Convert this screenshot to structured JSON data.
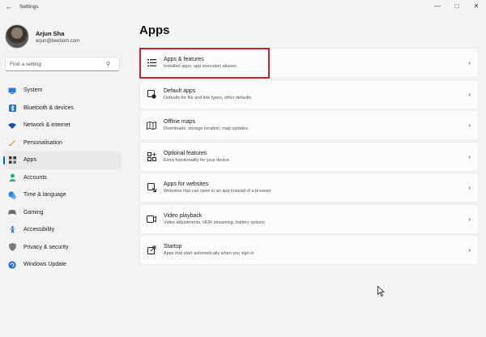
{
  "window": {
    "back_icon": "back-arrow-icon",
    "title": "Settings",
    "controls": [
      "minimize-icon",
      "maximize-icon",
      "close-icon"
    ]
  },
  "profile": {
    "name": "Arjun Sha",
    "email": "arjun@beebom.com"
  },
  "search": {
    "placeholder": "Find a setting",
    "icon": "search-icon"
  },
  "sidebar": {
    "items": [
      {
        "label": "System",
        "icon": "monitor-icon",
        "color": "#2b7cd3"
      },
      {
        "label": "Bluetooth & devices",
        "icon": "bluetooth-icon",
        "color": "#1f6fd1"
      },
      {
        "label": "Network & internet",
        "icon": "wifi-icon",
        "color": "#1f4fa8"
      },
      {
        "label": "Personalisation",
        "icon": "brush-icon",
        "color": "#e0a43a"
      },
      {
        "label": "Apps",
        "icon": "apps-icon",
        "color": "#3a3a3a",
        "active": true
      },
      {
        "label": "Accounts",
        "icon": "account-icon",
        "color": "#2aa88a"
      },
      {
        "label": "Time & language",
        "icon": "clock-globe-icon",
        "color": "#2b86d8"
      },
      {
        "label": "Gaming",
        "icon": "controller-icon",
        "color": "#6b6b6b"
      },
      {
        "label": "Accessibility",
        "icon": "accessibility-icon",
        "color": "#1f6fd1"
      },
      {
        "label": "Privacy & security",
        "icon": "shield-icon",
        "color": "#7a7a7a"
      },
      {
        "label": "Windows Update",
        "icon": "update-icon",
        "color": "#1f6fd1"
      }
    ]
  },
  "main": {
    "title": "Apps",
    "cards": [
      {
        "title": "Apps & features",
        "desc": "Installed apps, app execution aliases",
        "icon": "list-icon"
      },
      {
        "title": "Default apps",
        "desc": "Defaults for file and link types, other defaults",
        "icon": "default-apps-icon"
      },
      {
        "title": "Offline maps",
        "desc": "Downloads, storage location, map updates",
        "icon": "map-icon"
      },
      {
        "title": "Optional features",
        "desc": "Extra functionality for your device",
        "icon": "optional-features-icon"
      },
      {
        "title": "Apps for websites",
        "desc": "Websites that can open in an app instead of a browser",
        "icon": "web-app-icon"
      },
      {
        "title": "Video playback",
        "desc": "Video adjustments, HDR streaming, battery options",
        "icon": "video-icon"
      },
      {
        "title": "Startup",
        "desc": "Apps that start automatically when you sign in",
        "icon": "startup-icon"
      }
    ]
  },
  "accent_color": "#0067c0",
  "highlight_color": "#c0272d"
}
